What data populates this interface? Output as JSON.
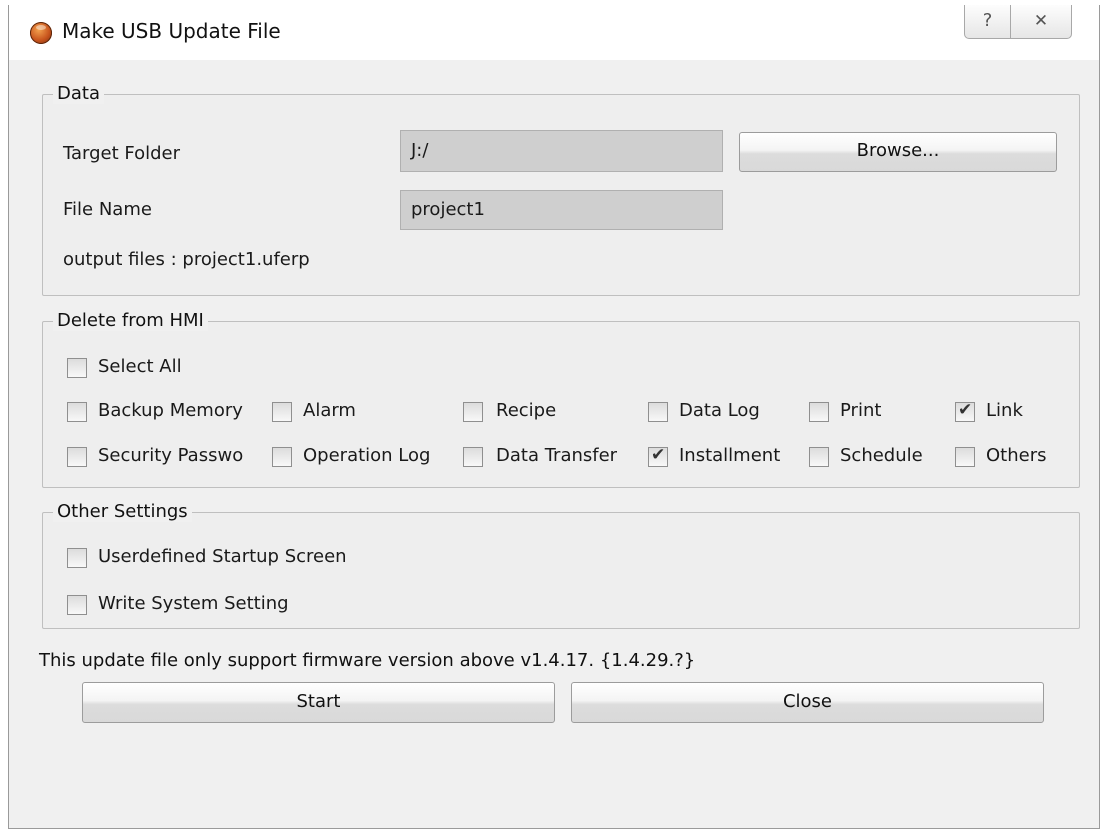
{
  "window": {
    "title": "Make USB Update File",
    "help_glyph": "?",
    "close_glyph": "X"
  },
  "data_group": {
    "title": "Data",
    "target_folder_label": "Target Folder",
    "target_folder_value": "J:/",
    "browse_label": "Browse...",
    "file_name_label": "File Name",
    "file_name_value": "project1",
    "output_files": "output files : project1.uferp"
  },
  "delete_group": {
    "title": "Delete from HMI",
    "select_all": {
      "label": "Select All",
      "checked": false
    },
    "items": [
      {
        "label": "Backup Memory",
        "checked": false
      },
      {
        "label": "Alarm",
        "checked": false
      },
      {
        "label": "Recipe",
        "checked": false
      },
      {
        "label": "Data Log",
        "checked": false
      },
      {
        "label": "Print",
        "checked": false
      },
      {
        "label": "Link",
        "checked": true
      },
      {
        "label": "Security Passwo",
        "checked": false
      },
      {
        "label": "Operation Log",
        "checked": false
      },
      {
        "label": "Data Transfer",
        "checked": false
      },
      {
        "label": "Installment",
        "checked": true
      },
      {
        "label": "Schedule",
        "checked": false
      },
      {
        "label": "Others",
        "checked": false
      }
    ]
  },
  "other_group": {
    "title": "Other Settings",
    "items": [
      {
        "label": "Userdefined Startup Screen",
        "checked": false
      },
      {
        "label": "Write System Setting",
        "checked": false
      }
    ]
  },
  "footer": {
    "note": "This update file only support firmware version above v1.4.17. {1.4.29.?}",
    "start_label": "Start",
    "close_label": "Close"
  }
}
